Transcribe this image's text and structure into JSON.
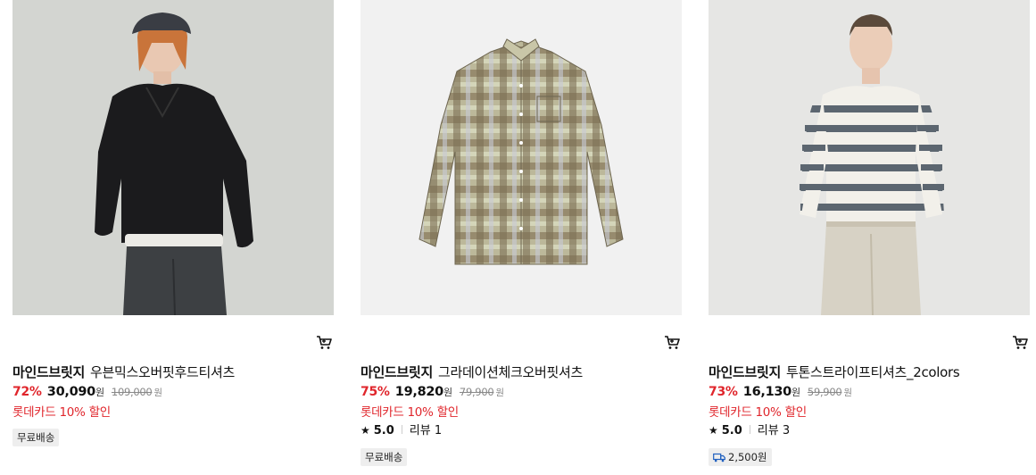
{
  "products": [
    {
      "brand": "마인드브릿지",
      "name": "우븐믹스오버핏후드티셔츠",
      "discount": "72%",
      "sale_price": "30,090",
      "currency": "원",
      "original_price": "109,000",
      "card_promo": "롯데카드 10% 할인",
      "badge": "무료배송"
    },
    {
      "brand": "마인드브릿지",
      "name": "그라데이션체크오버핏셔츠",
      "discount": "75%",
      "sale_price": "19,820",
      "currency": "원",
      "original_price": "79,900",
      "card_promo": "롯데카드 10% 할인",
      "rating": "5.0",
      "review_label": "리뷰 1",
      "badge": "무료배송"
    },
    {
      "brand": "마인드브릿지",
      "name": "투톤스트라이프티셔츠_2colors",
      "discount": "73%",
      "sale_price": "16,130",
      "currency": "원",
      "original_price": "59,900",
      "card_promo": "롯데카드 10% 할인",
      "rating": "5.0",
      "review_label": "리뷰 3",
      "badge": "2,500원"
    }
  ],
  "colors": {
    "discount": "#e0262c",
    "badge_bg": "#eeeeee"
  },
  "icons": {
    "cart": "cart-icon",
    "star": "star-icon",
    "truck": "truck-icon"
  }
}
